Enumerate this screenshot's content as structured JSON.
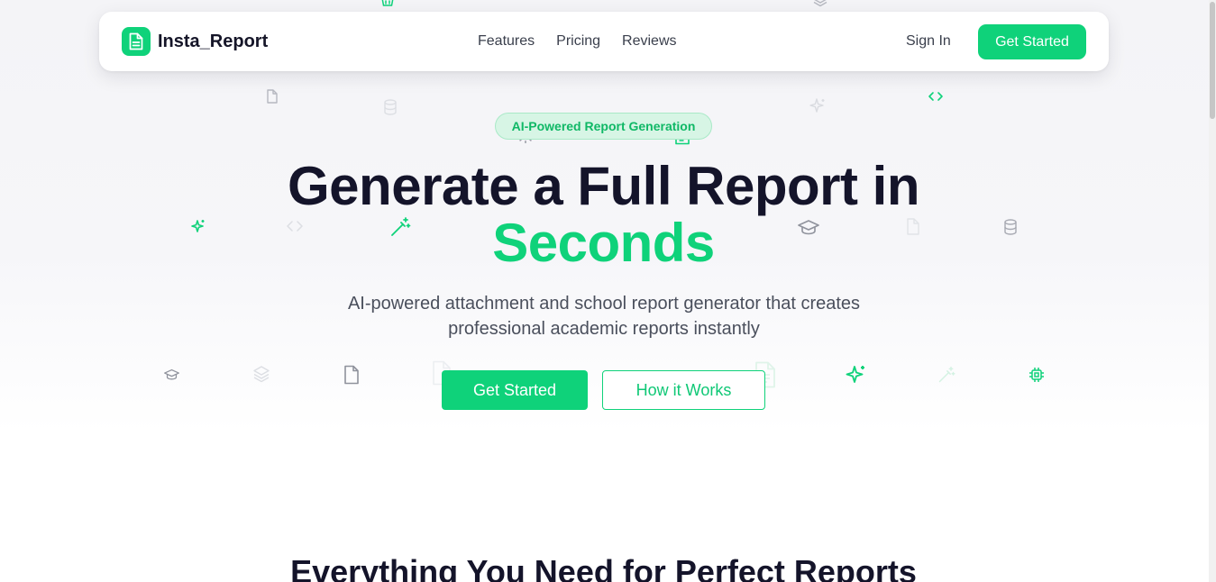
{
  "nav": {
    "brand": "Insta_Report",
    "links": [
      "Features",
      "Pricing",
      "Reviews"
    ],
    "signin": "Sign In",
    "cta": "Get Started"
  },
  "hero": {
    "badge": "AI-Powered Report Generation",
    "title": "Generate a Full Report in",
    "highlight": "Seconds",
    "subtitle_line1": "AI-powered attachment and school report generator that creates",
    "subtitle_line2": "professional academic reports instantly",
    "primary_button": "Get Started",
    "secondary_button": "How it Works"
  },
  "features": {
    "title": "Everything You Need for Perfect Reports"
  },
  "colors": {
    "accent": "#0fd27a",
    "heading": "#14142a",
    "body_text": "#4a4f5c"
  },
  "icons": {
    "brand": "document-icon",
    "floating": [
      "document-icon",
      "database-icon",
      "sparkles-icon",
      "code-icon",
      "gear-icon",
      "magic-wand-icon",
      "graduation-cap-icon",
      "layers-icon",
      "chip-icon"
    ]
  }
}
